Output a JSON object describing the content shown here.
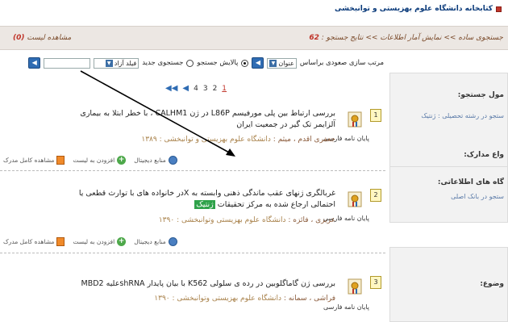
{
  "header": {
    "title": "کتابخانه دانشگاه علوم بهزیستی و توانبخشی"
  },
  "breadcrumb": {
    "text": "جستجوی ساده >> نمایش آمار اطلاعات >> نتایج جستجو :",
    "count": "62"
  },
  "view_list": {
    "label": "مشاهده لیست",
    "count": "(0)"
  },
  "sort": {
    "label": "مرتب سازی صعودی براساس",
    "selected": "عنوان",
    "option_search_in_results": "پالایش جستجو",
    "option_new_search": "جستجوی جدید",
    "field_label": "فیلد آزاد"
  },
  "pager": {
    "pages": [
      "1",
      "2",
      "3",
      "4"
    ],
    "current": "1"
  },
  "sidebar": {
    "search_fields_title": "مول جستجو:",
    "search_fields_value": "ستجو در رشته تحصیلی : ژنتیک",
    "doc_types_title": "واع مدارک:",
    "databases_title": "گاه های اطلاعاتی:",
    "databases_value": "ستجو در بانک اصلی",
    "subject_title": "وضوع:"
  },
  "results": [
    {
      "num": "1",
      "type": "پایان نامه فارسی",
      "title": "بررسی ارتباط بین پلی مورفیسم L86P در ژن CALHM1 ، با خطر ابتلا به بیماری آلزایمر تک گیر در جمعیت ایران",
      "authors": "جعفری اقدم ، میثم :",
      "publisher": "دانشگاه علوم بهزیستی و توانبخشی :",
      "year": "۱۳۸۹",
      "actions": {
        "digital": "منابع دیجیتال",
        "add": "افزودن به لیست",
        "full": "مشاهده کامل مدرک"
      }
    },
    {
      "num": "2",
      "type": "پایان نامه فارسی",
      "title_before": "غربالگری ژنهای عقب ماندگی ذهنی وابسته به Xدر خانواده های با توارث قطعی یا احتمالی ارجاع شده به مرکز تحقیقات",
      "title_highlight": "ژنتیک",
      "authors": "عزیزی ، فائزه :",
      "publisher": "دانشگاه علوم بهزیستی وتوانبخشی :",
      "year": "۱۳۹۰",
      "actions": {
        "digital": "منابع دیجیتال",
        "add": "افزودن به لیست",
        "full": "مشاهده کامل مدرک"
      }
    },
    {
      "num": "3",
      "type": "پایان نامه فارسی",
      "title": "بررسی ژن گاماگلوبین در رده ی سلولی K562 با بیان پایدار shRNAعلیه MBD2",
      "authors": "فراشی ، سمانه :",
      "publisher": "دانشگاه علوم بهزیستی وتوانبخشی :",
      "year": "۱۳۹۰"
    }
  ]
}
